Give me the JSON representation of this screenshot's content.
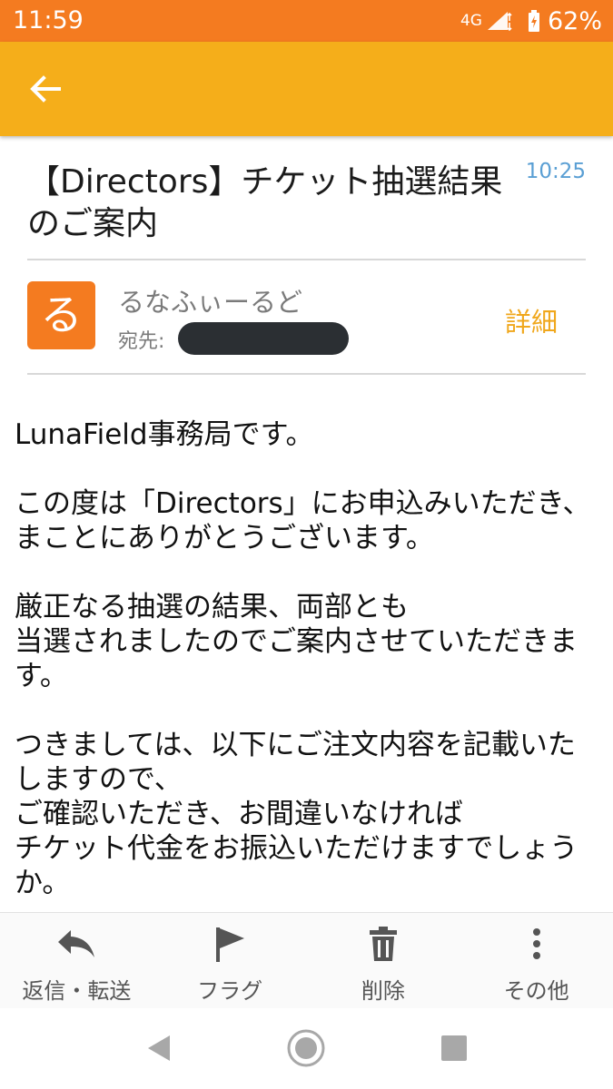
{
  "status_bar": {
    "time": "11:59",
    "network": "4G",
    "battery": "62%"
  },
  "message": {
    "subject": "【Directors】チケット抽選結果のご案内",
    "time": "10:25",
    "sender_initial": "る",
    "sender_name": "るなふぃーるど",
    "recipient_label": "宛先:",
    "detail_label": "詳細"
  },
  "body": {
    "paragraphs": [
      "LunaField事務局です。",
      "この度は「Directors」にお申込みいただき、\nまことにありがとうございます。",
      "厳正なる抽選の結果、両部とも\n当選されましたのでご案内させていただきます。",
      "つきましては、以下にご注文内容を記載いたしますので、\nご確認いただき、お間違いなければ\nチケット代金をお振込いただけますでしょうか。"
    ]
  },
  "actions": {
    "reply": "返信・転送",
    "flag": "フラグ",
    "delete": "削除",
    "more": "その他"
  },
  "colors": {
    "status_bar": "#f47b20",
    "app_bar": "#f5ae1a",
    "accent": "#f0a71c",
    "time": "#5a9fd4"
  }
}
